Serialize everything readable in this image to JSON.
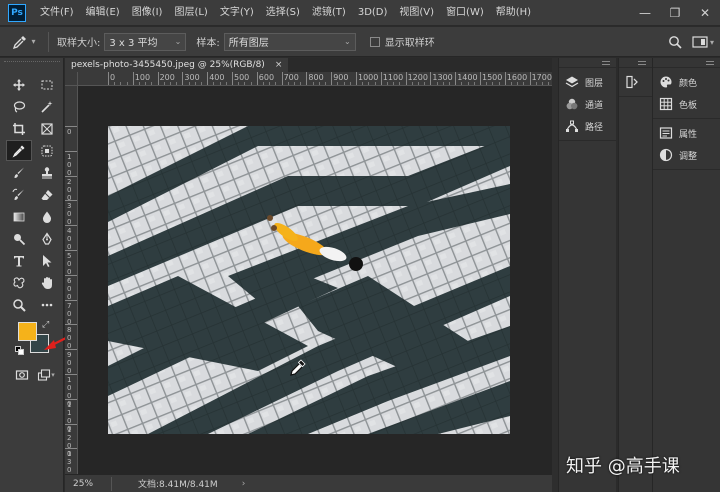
{
  "app": {
    "logo_text": "Ps",
    "menu": [
      "文件(F)",
      "编辑(E)",
      "图像(I)",
      "图层(L)",
      "文字(Y)",
      "选择(S)",
      "滤镜(T)",
      "3D(D)",
      "视图(V)",
      "窗口(W)",
      "帮助(H)"
    ],
    "window_controls": {
      "minimize": "—",
      "maximize": "❐",
      "close": "✕"
    }
  },
  "options_bar": {
    "sample_size_label": "取样大小:",
    "sample_size_value": "3 x 3 平均",
    "sample_label": "样本:",
    "sample_value": "所有图层",
    "show_ring_label": "显示取样环",
    "show_ring_checked": false
  },
  "toolbar": {
    "active_tool": "eyedropper-tool",
    "foreground_color": "#f5b21a",
    "background_color": "#334548"
  },
  "document": {
    "tab_title": "pexels-photo-3455450.jpeg @ 25%(RGB/8)",
    "tab_close": "×",
    "ruler_top": [
      "0",
      "100",
      "200",
      "300",
      "400",
      "500",
      "600",
      "700",
      "800",
      "900",
      "1000",
      "1100",
      "1200",
      "1300",
      "1400",
      "1500",
      "1600",
      "1700",
      "1800",
      "1900"
    ],
    "ruler_left": [
      "0",
      "100",
      "200",
      "300",
      "400",
      "500",
      "600",
      "700",
      "800",
      "900",
      "1000",
      "1100",
      "1200",
      "1300",
      "1400",
      "1500"
    ]
  },
  "status_bar": {
    "zoom": "25%",
    "doc_info": "文档:8.41M/8.41M",
    "arrow": "›"
  },
  "panels": {
    "group1": [
      {
        "label": "图层",
        "icon": "layers-icon"
      },
      {
        "label": "通道",
        "icon": "channels-icon"
      },
      {
        "label": "路径",
        "icon": "paths-icon"
      }
    ],
    "group3a": [
      {
        "label": "颜色",
        "icon": "palette-icon"
      },
      {
        "label": "色板",
        "icon": "swatches-icon"
      }
    ],
    "group3b": [
      {
        "label": "属性",
        "icon": "properties-icon"
      },
      {
        "label": "调整",
        "icon": "adjustments-icon"
      }
    ]
  },
  "watermark": "知乎 @高手课"
}
